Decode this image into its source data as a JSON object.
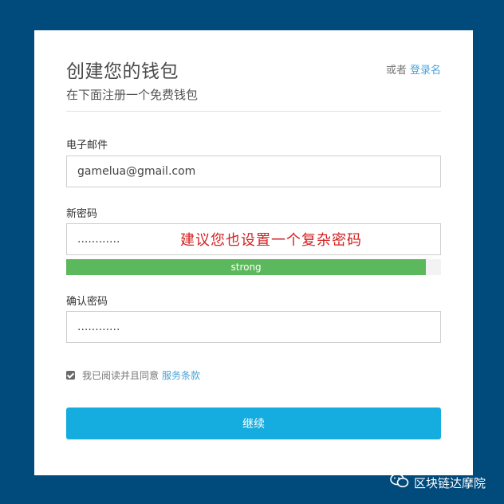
{
  "header": {
    "title": "创建您的钱包",
    "subtitle": "在下面注册一个免费钱包",
    "alt_prefix": "或者",
    "alt_link": "登录名"
  },
  "form": {
    "email_label": "电子邮件",
    "email_value": "gamelua@gmail.com",
    "password_label": "新密码",
    "password_value": "............",
    "annotation": "建议您也设置一个复杂密码",
    "strength_label": "strong",
    "strength_fraction": 0.96,
    "strength_color": "#5cb85c",
    "confirm_label": "确认密码",
    "confirm_value": "............",
    "agree_text": "我已阅读并且同意",
    "terms_link": "服务条款",
    "agree_checked": true,
    "submit_label": "继续"
  },
  "watermark": {
    "text": "区块链达摩院",
    "icon": "wechat-icon"
  },
  "colors": {
    "background": "#004a7c",
    "accent": "#15acdf",
    "link": "#4aa3d8",
    "annotation": "#d42020"
  }
}
